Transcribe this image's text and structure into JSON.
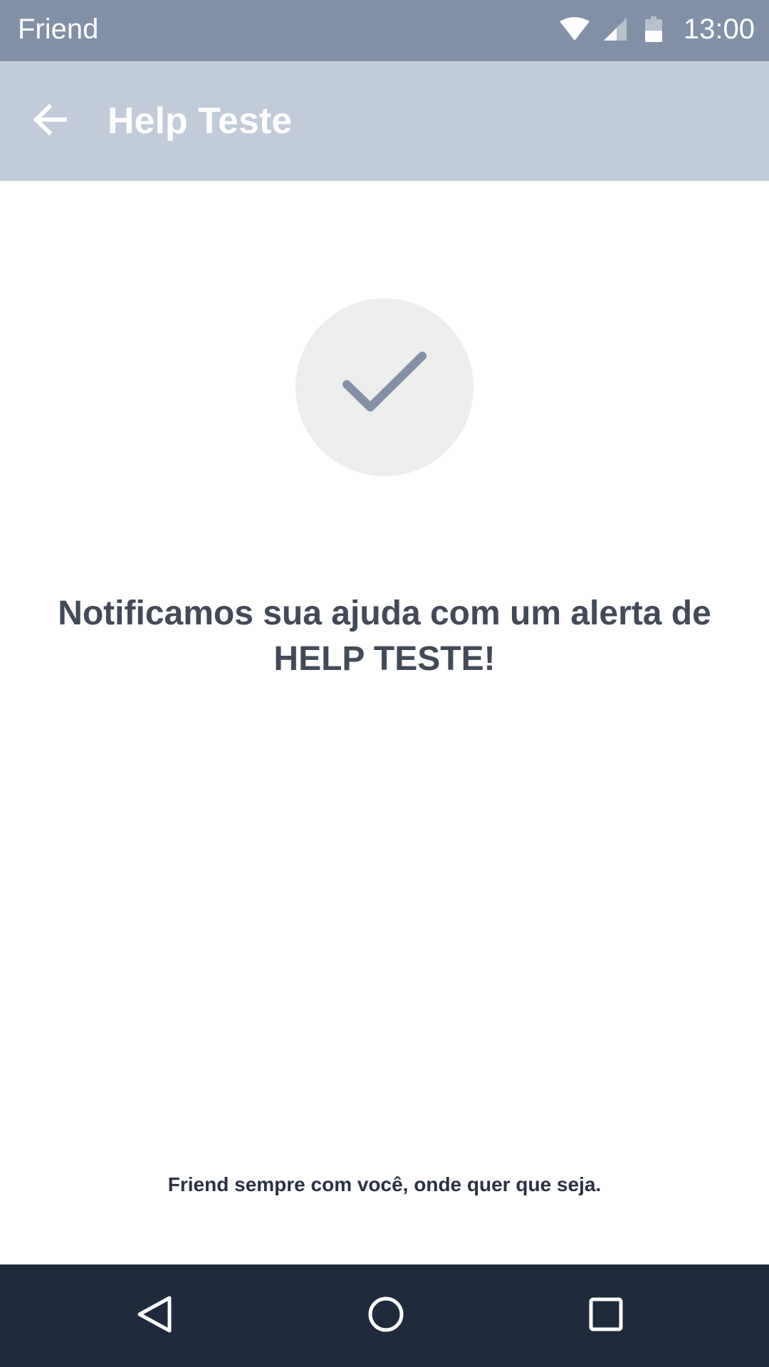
{
  "status_bar": {
    "app_name": "Friend",
    "time": "13:00",
    "icons": [
      "wifi-icon",
      "signal-icon",
      "battery-icon"
    ],
    "background": "#8190a6"
  },
  "app_bar": {
    "title": "Help Teste",
    "back_icon": "arrow-back-icon",
    "background": "#c1cbd9"
  },
  "content": {
    "check_icon": "check-icon",
    "message": "Notificamos sua ajuda com um alerta de HELP TESTE!",
    "footer": "Friend sempre com você, onde quer que seja."
  },
  "nav_bar": {
    "icons": [
      "nav-back-icon",
      "nav-home-icon",
      "nav-recents-icon"
    ],
    "background": "#1f2b3c"
  }
}
